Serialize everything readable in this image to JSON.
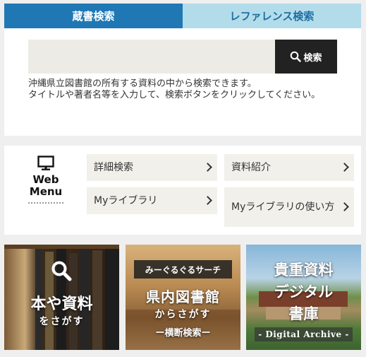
{
  "tabs": [
    {
      "label": "蔵書検索",
      "active": true
    },
    {
      "label": "レファレンス検索",
      "active": false
    }
  ],
  "search": {
    "placeholder": "",
    "button_label": "検索",
    "button_icon": "search-icon",
    "help_text": "沖縄県立図書館の所有する資料の中から検索できます。\nタイトルや著者名等を入力して、検索ボタンをクリックしてください。"
  },
  "web_menu": {
    "icon": "monitor-icon",
    "title": "Web\nMenu",
    "items": [
      {
        "label": "詳細検索"
      },
      {
        "label": "資料紹介"
      },
      {
        "label": "Myライブラリ"
      },
      {
        "label": "Myライブラリの使い方"
      }
    ]
  },
  "banners": [
    {
      "icon": "search-icon",
      "title": "本や資料",
      "subtitle": "をさがす"
    },
    {
      "tag": "みーぐるぐるサーチ",
      "title": "県内図書館",
      "subtitle": "からさがす",
      "caption": "ー横断検索ー"
    },
    {
      "title_line1": "貴重資料",
      "title_line2": "デジタル",
      "title_line3": "書庫",
      "caption": "- Digital Archive -"
    }
  ],
  "colors": {
    "tab_active_bg": "#1f78b4",
    "tab_inactive_bg": "#b3dcea",
    "search_button_bg": "#222222",
    "menu_item_bg": "#f1f0eb"
  }
}
